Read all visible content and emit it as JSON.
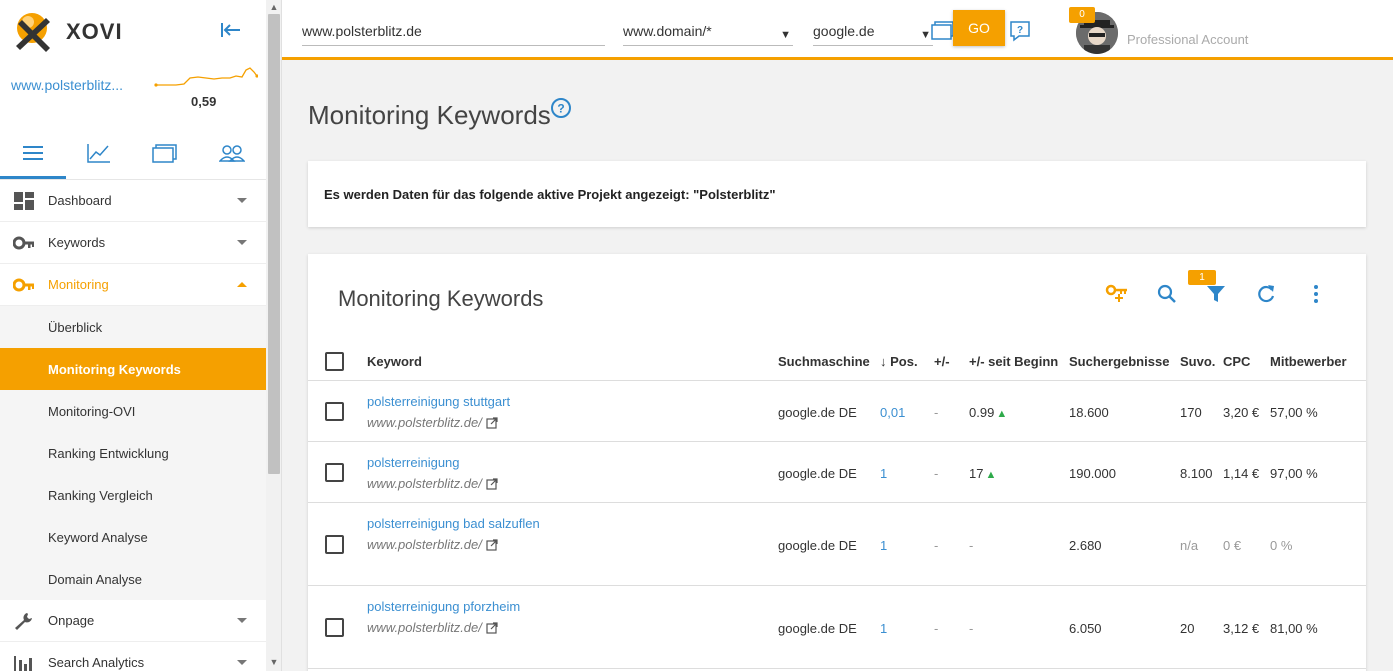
{
  "sidebar": {
    "logo_text": "XOVI",
    "project_domain": "www.polsterblitz...",
    "visibility_value": "0,59",
    "nav": [
      {
        "label": "Dashboard",
        "icon": "dashboard-icon"
      },
      {
        "label": "Keywords",
        "icon": "key-icon"
      },
      {
        "label": "Monitoring",
        "icon": "key-icon",
        "open": true,
        "children": [
          {
            "label": "Überblick"
          },
          {
            "label": "Monitoring Keywords",
            "active": true
          },
          {
            "label": "Monitoring-OVI"
          },
          {
            "label": "Ranking Entwicklung"
          },
          {
            "label": "Ranking Vergleich"
          },
          {
            "label": "Keyword Analyse"
          },
          {
            "label": "Domain Analyse"
          }
        ]
      },
      {
        "label": "Onpage",
        "icon": "wrench-icon"
      },
      {
        "label": "Search Analytics",
        "icon": "bar-chart-icon"
      }
    ]
  },
  "header": {
    "domain_value": "www.polsterblitz.de",
    "scope_value": "www.domain/*",
    "engine_value": "google.de",
    "go_label": "GO",
    "notification_count": "0",
    "account_label": "Professional Account"
  },
  "page": {
    "title": "Monitoring Keywords",
    "info_text": "Es werden Daten für das folgende aktive Projekt angezeigt: \"Polsterblitz\""
  },
  "table": {
    "title": "Monitoring Keywords",
    "filter_count": "1",
    "columns": {
      "keyword": "Keyword",
      "engine": "Suchmaschine",
      "pos": "Pos.",
      "diff": "+/-",
      "since_start": "+/- seit Beginn",
      "results": "Suchergebnisse",
      "suvo": "Suvo.",
      "cpc": "CPC",
      "competitors": "Mitbewerber"
    },
    "rows": [
      {
        "keyword": "polsterreinigung stuttgart",
        "url": "www.polsterblitz.de/",
        "engine": "google.de DE",
        "pos": "0,01",
        "diff": "-",
        "since_start": "0.99",
        "since_up": true,
        "results": "18.600",
        "suvo": "170",
        "cpc": "3,20 €",
        "competitors": "57,00 %",
        "muted": false
      },
      {
        "keyword": "polsterreinigung",
        "url": "www.polsterblitz.de/",
        "engine": "google.de DE",
        "pos": "1",
        "diff": "-",
        "since_start": "17",
        "since_up": true,
        "results": "190.000",
        "suvo": "8.100",
        "cpc": "1,14 €",
        "competitors": "97,00 %",
        "muted": false
      },
      {
        "keyword": "polsterreinigung bad salzuflen",
        "url": "www.polsterblitz.de/",
        "engine": "google.de DE",
        "pos": "1",
        "diff": "-",
        "since_start": "-",
        "since_up": false,
        "results": "2.680",
        "suvo": "n/a",
        "cpc": "0 €",
        "competitors": "0 %",
        "muted": true
      },
      {
        "keyword": "polsterreinigung pforzheim",
        "url": "www.polsterblitz.de/",
        "engine": "google.de DE",
        "pos": "1",
        "diff": "-",
        "since_start": "-",
        "since_up": false,
        "results": "6.050",
        "suvo": "20",
        "cpc": "3,12 €",
        "competitors": "81,00 %",
        "muted": false
      }
    ]
  }
}
